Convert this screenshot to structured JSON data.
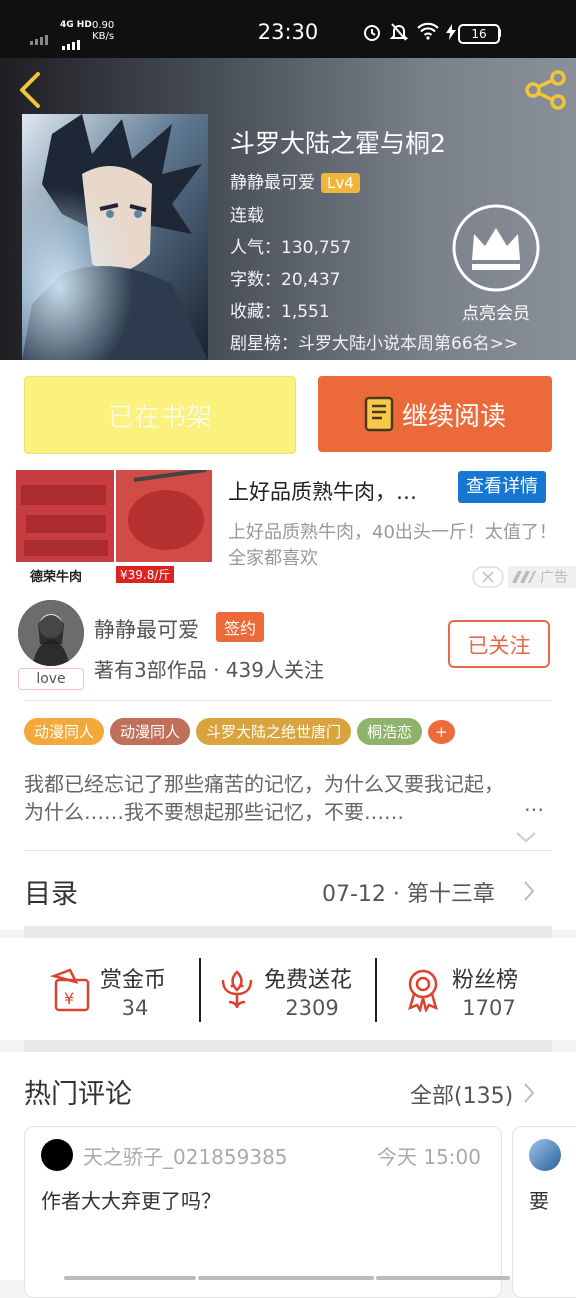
{
  "status_bar": {
    "network": "4G HD",
    "speed_value": "0.90",
    "speed_unit": "KB/s",
    "time": "23:30",
    "battery": "16"
  },
  "book": {
    "title": "斗罗大陆之霍与桐2",
    "author": "静静最可爱",
    "level": "Lv4",
    "status": "连载",
    "popularity": "人气：130,757",
    "words": "字数：20,437",
    "favorites": "收藏：1,551",
    "ranking": "剧星榜：斗罗大陆小说本周第66名>>",
    "vip_label": "点亮会员"
  },
  "actions": {
    "shelf_label": "已在书架",
    "read_label": "继续阅读"
  },
  "ad": {
    "title": "上好品质熟牛肉，…",
    "detail_button": "查看详情",
    "description": "上好品质熟牛肉，40出头一斤！太值了！全家都喜欢",
    "ad_label": "广告",
    "image_caption": "德荣牛肉",
    "image_price": "¥39.8/斤"
  },
  "author": {
    "name": "静静最可爱",
    "signed_badge": "签约",
    "stats": "著有3部作品 · 439人关注",
    "follow_label": "已关注",
    "avatar_tag": "love",
    "tags": [
      "动漫同人",
      "动漫同人",
      "斗罗大陆之绝世唐门",
      "桐浩恋",
      "+"
    ],
    "tag_colors": [
      "#f2a93b",
      "#c0705a",
      "#d9a43d",
      "#8fb36a",
      "#ee6a3a"
    ],
    "synopsis": "我都已经忘记了那些痛苦的记忆，为什么又要我记起，为什么……我不要想起那些记忆，不要……",
    "more": "…"
  },
  "catalog": {
    "label": "目录",
    "latest": "07-12 · 第十三章"
  },
  "stats": {
    "reward_label": "赏金币",
    "reward_value": "34",
    "flower_label": "免费送花",
    "flower_value": "2309",
    "fans_label": "粉丝榜",
    "fans_value": "1707"
  },
  "comments": {
    "title": "热门评论",
    "all_label": "全部(135)",
    "items": [
      {
        "user": "天之骄子_021859385",
        "time": "今天 15:00",
        "text": "作者大大弃更了吗？"
      },
      {
        "text": "要"
      }
    ]
  },
  "colors": {
    "accent_orange": "#ec6a3a",
    "shelf_yellow": "#fbf27d",
    "ad_blue": "#1677d2"
  }
}
